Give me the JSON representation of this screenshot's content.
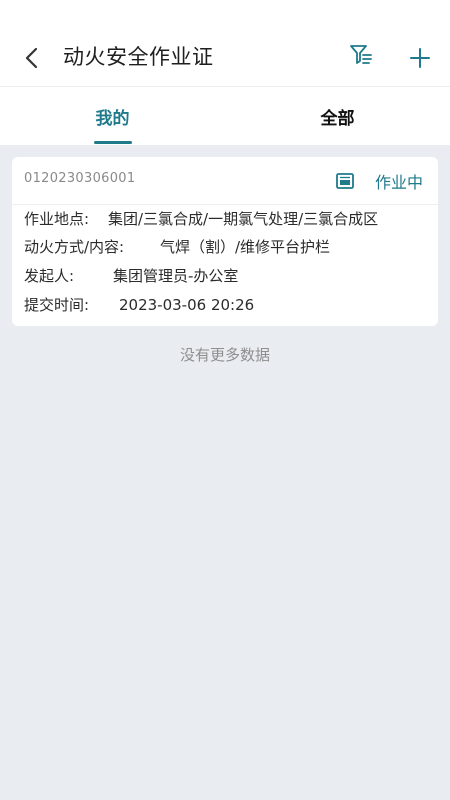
{
  "header": {
    "title": "动火安全作业证",
    "back_icon": "chevron-left-icon",
    "filter_icon": "filter-icon",
    "add_icon": "plus-icon"
  },
  "tabs": [
    {
      "label": "我的",
      "active": true
    },
    {
      "label": "全部",
      "active": false
    }
  ],
  "colors": {
    "accent": "#1f7a8c",
    "background": "#e9ecf0"
  },
  "permits": [
    {
      "id": "0120230306001",
      "status": "作业中",
      "status_icon": "certificate-icon",
      "location_label": "作业地点:",
      "location": "集团/三氯合成/一期氯气处理/三氯合成区",
      "method_label": "动火方式/内容:",
      "method": "气焊（割）/维修平台护栏",
      "initiator_label": "发起人:",
      "initiator": "集团管理员-办公室",
      "submit_time_label": "提交时间:",
      "submit_time": "2023-03-06 20:26"
    }
  ],
  "list_footer": "没有更多数据"
}
